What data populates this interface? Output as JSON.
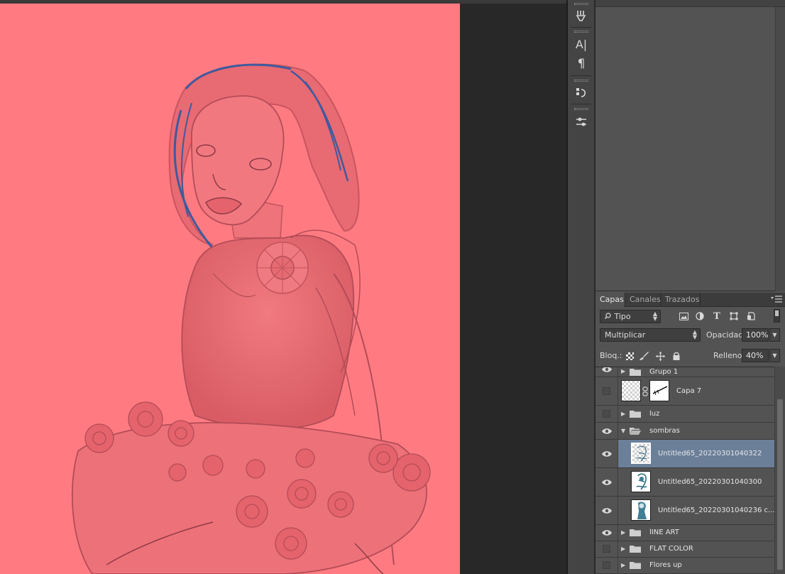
{
  "panel": {
    "tabs": [
      {
        "label": "Capas"
      },
      {
        "label": "Canales"
      },
      {
        "label": "Trazados"
      }
    ],
    "filter": {
      "label": "Tipo"
    },
    "blend_mode": "Multiplicar",
    "opacity_label": "Opacidad:",
    "opacity_value": "100%",
    "lock_label": "Bloq.:",
    "fill_label": "Relleno:",
    "fill_value": "40%"
  },
  "tools": {
    "text_glyph": "A|",
    "paragraph_glyph": "¶"
  },
  "layers": [
    {
      "name": "Grupo 1",
      "visible": true
    },
    {
      "name": "Capa 7",
      "visible": false
    },
    {
      "name": "luz",
      "visible": false
    },
    {
      "name": "sombras",
      "visible": true
    },
    {
      "name": "Untitled65_20220301040322",
      "visible": true
    },
    {
      "name": "Untitled65_20220301040300",
      "visible": true
    },
    {
      "name": "Untitled65_20220301040236 c...",
      "visible": true
    },
    {
      "name": "lINE ART",
      "visible": true
    },
    {
      "name": "FLAT COLOR",
      "visible": false
    },
    {
      "name": "Flores up",
      "visible": false
    }
  ],
  "colors": {
    "canvas": "#ff7b81",
    "selected_row": "#6b7f99",
    "hair_outline": "#3f5a9e"
  }
}
